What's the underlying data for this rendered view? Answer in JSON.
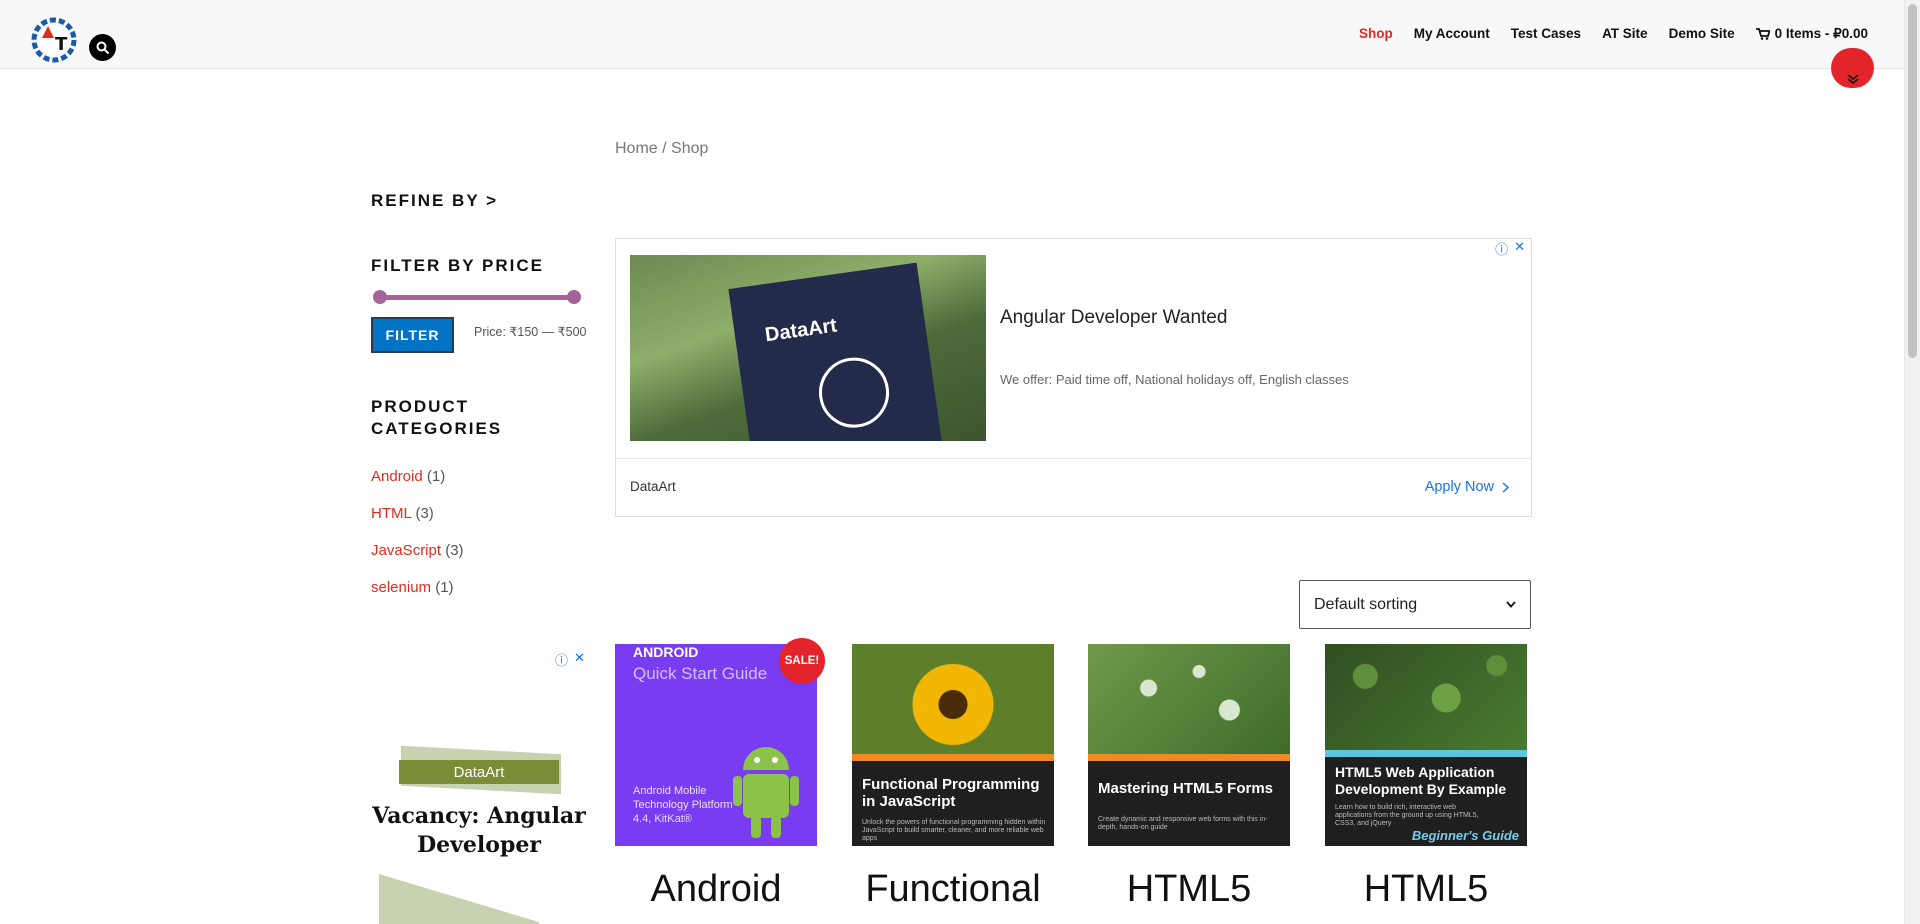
{
  "header": {
    "nav": [
      {
        "label": "Shop",
        "active": true
      },
      {
        "label": "My Account",
        "active": false
      },
      {
        "label": "Test Cases",
        "active": false
      },
      {
        "label": "AT Site",
        "active": false
      },
      {
        "label": "Demo Site",
        "active": false
      }
    ],
    "cart_label": "0 Items - ₽0.00"
  },
  "breadcrumb": "Home / Shop",
  "sidebar": {
    "refine_title": "REFINE BY >",
    "filter_title": "FILTER BY PRICE",
    "filter_button": "FILTER",
    "price_text": "Price: ₹150 — ₹500",
    "categories_title": "PRODUCT CATEGORIES",
    "categories": [
      {
        "name": "Android",
        "count": "(1)"
      },
      {
        "name": "HTML",
        "count": "(3)"
      },
      {
        "name": "JavaScript",
        "count": "(3)"
      },
      {
        "name": "selenium",
        "count": "(1)"
      }
    ],
    "ad": {
      "badge": "DataArt",
      "title": "Vacancy: Angular Developer"
    }
  },
  "main_ad": {
    "image_brand": "DataArt",
    "title": "Angular Developer Wanted",
    "description": "We offer: Paid time off, National holidays off, English classes",
    "brand": "DataArt",
    "cta": "Apply Now"
  },
  "sorting": {
    "selected": "Default sorting"
  },
  "products": [
    {
      "title": "Android",
      "sale": "SALE!",
      "cover": {
        "line1": "ANDROID",
        "line2": "Quick Start Guide",
        "line3": "Android Mobile Technology Platform 4.4, KitKat®"
      }
    },
    {
      "title": "Functional",
      "cover": {
        "title": "Functional Programming in JavaScript",
        "sub": "Unlock the powers of functional programming hidden within JavaScript to build smarter, cleaner, and more reliable web apps"
      }
    },
    {
      "title": "HTML5",
      "cover": {
        "title": "Mastering HTML5 Forms",
        "sub": "Create dynamic and responsive web forms with this in-depth, hands-on guide"
      }
    },
    {
      "title": "HTML5",
      "cover": {
        "title": "HTML5 Web Application Development By Example",
        "sub": "Learn how to build rich, interactive web applications from the ground up using HTML5, CSS3, and jQuery",
        "guide": "Beginner's Guide"
      }
    }
  ],
  "colors": {
    "accent": "#e02b20",
    "filter_button": "#0073c4",
    "slider": "#a46497",
    "link_blue": "#1a73e8"
  },
  "icons": [
    "logo-icon",
    "search-icon",
    "cart-icon",
    "chevron-down-icon",
    "info-icon",
    "close-icon",
    "chevron-right-icon"
  ]
}
